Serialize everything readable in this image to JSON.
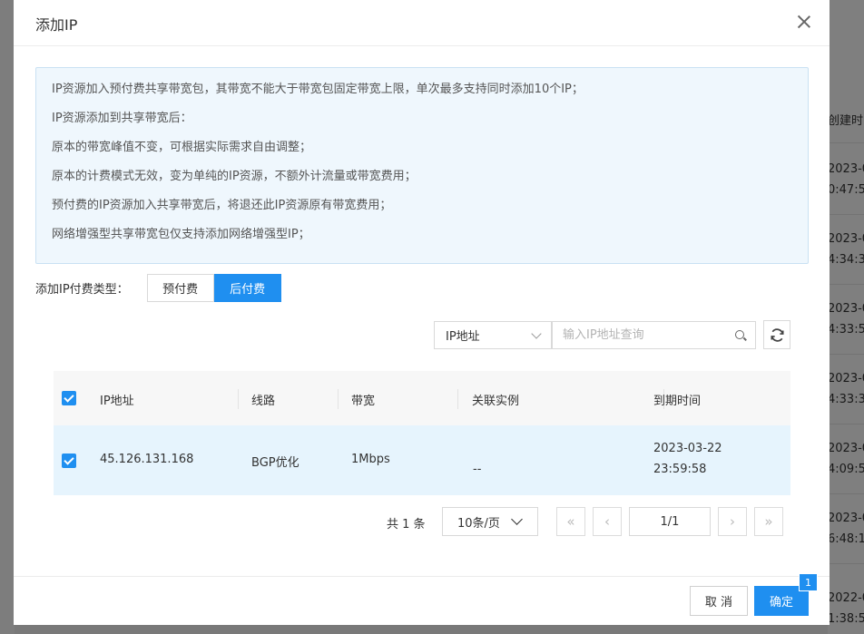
{
  "background": {
    "column_header": "创建时",
    "rows": [
      [
        "2023-0",
        "0:47:5"
      ],
      [
        "2023-0",
        "4:34:3"
      ],
      [
        "2023-0",
        "4:33:5"
      ],
      [
        "2023-0",
        "4:33:3"
      ],
      [
        "2023-0",
        "4:09:5"
      ],
      [
        "2023-0",
        "6:48:1"
      ],
      [
        "2022-0",
        "1:38:5"
      ]
    ]
  },
  "modal": {
    "title": "添加IP",
    "notice": [
      "IP资源加入预付费共享带宽包，其带宽不能大于带宽包固定带宽上限，单次最多支持同时添加10个IP；",
      "IP资源添加到共享带宽后：",
      "原本的带宽峰值不变，可根据实际需求自由调整；",
      "原本的计费模式无效，变为单纯的IP资源，不额外计流量或带宽费用；",
      "预付费的IP资源加入共享带宽后，将退还此IP资源原有带宽费用；",
      "网络增强型共享带宽包仅支持添加网络增强型IP；"
    ],
    "pay_type": {
      "label": "添加IP付费类型：",
      "options": [
        "预付费",
        "后付费"
      ],
      "selected": "后付费"
    },
    "filter": {
      "field": "IP地址",
      "placeholder": "输入IP地址查询",
      "value": ""
    },
    "table": {
      "columns": [
        "IP地址",
        "线路",
        "带宽",
        "关联实例",
        "到期时间"
      ],
      "rows": [
        {
          "checked": true,
          "ip": "45.126.131.168",
          "line": "BGP优化",
          "bandwidth": "1Mbps",
          "instance": "--",
          "expire_date": "2023-03-22",
          "expire_time": "23:59:58"
        }
      ]
    },
    "pagination": {
      "total": "共 1 条",
      "page_size": "10条/页",
      "page": "1/1",
      "first": "«",
      "prev": "‹",
      "next": "›",
      "last": "»"
    },
    "footer": {
      "cancel": "取 消",
      "ok": "确定",
      "badge": "1"
    }
  },
  "colors": {
    "primary": "#1f8ff0",
    "notice_bg": "#eff7fd",
    "selected_row": "#e6f4fd"
  }
}
